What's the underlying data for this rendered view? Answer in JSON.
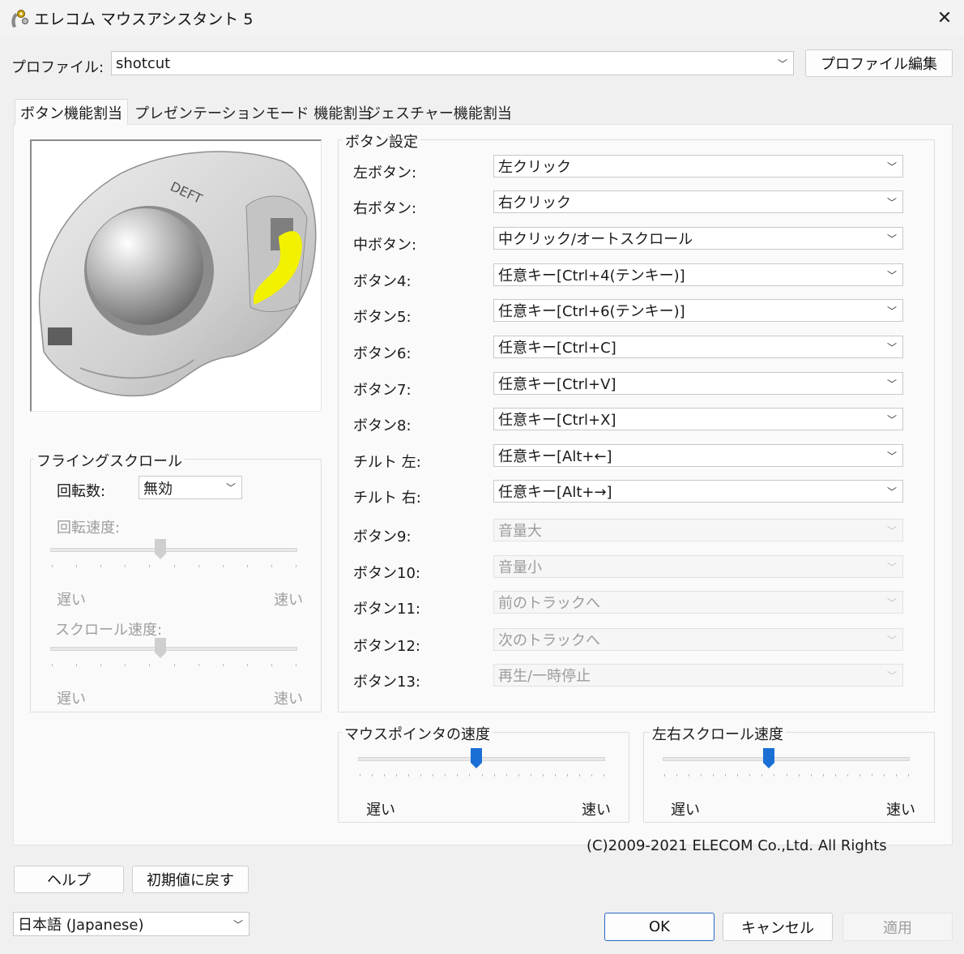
{
  "window": {
    "title": "エレコム マウスアシスタント 5",
    "close_icon": "close-icon"
  },
  "profile": {
    "label": "プロファイル:",
    "value": "shotcut",
    "edit_button": "プロファイル編集"
  },
  "tabs": [
    {
      "label": "ボタン機能割当",
      "active": true
    },
    {
      "label": "プレゼンテーションモード 機能割当",
      "active": false
    },
    {
      "label": "ジェスチャー機能割当",
      "active": false
    }
  ],
  "button_settings": {
    "title": "ボタン設定",
    "rows": [
      {
        "label": "左ボタン:",
        "value": "左クリック",
        "enabled": true
      },
      {
        "label": "右ボタン:",
        "value": "右クリック",
        "enabled": true
      },
      {
        "label": "中ボタン:",
        "value": "中クリック/オートスクロール",
        "enabled": true
      },
      {
        "label": "ボタン4:",
        "value": "任意キー[Ctrl+4(テンキー)]",
        "enabled": true
      },
      {
        "label": "ボタン5:",
        "value": "任意キー[Ctrl+6(テンキー)]",
        "enabled": true
      },
      {
        "label": "ボタン6:",
        "value": "任意キー[Ctrl+C]",
        "enabled": true
      },
      {
        "label": "ボタン7:",
        "value": "任意キー[Ctrl+V]",
        "enabled": true
      },
      {
        "label": "ボタン8:",
        "value": "任意キー[Ctrl+X]",
        "enabled": true
      },
      {
        "label": "チルト 左:",
        "value": "任意キー[Alt+←]",
        "enabled": true
      },
      {
        "label": "チルト 右:",
        "value": "任意キー[Alt+→]",
        "enabled": true
      },
      {
        "label": "ボタン9:",
        "value": "音量大",
        "enabled": false
      },
      {
        "label": "ボタン10:",
        "value": "音量小",
        "enabled": false
      },
      {
        "label": "ボタン11:",
        "value": "前のトラックへ",
        "enabled": false
      },
      {
        "label": "ボタン12:",
        "value": "次のトラックへ",
        "enabled": false
      },
      {
        "label": "ボタン13:",
        "value": "再生/一時停止",
        "enabled": false
      }
    ]
  },
  "flying_scroll": {
    "title": "フライングスクロール",
    "rotation_label": "回転数:",
    "rotation_value": "無効",
    "rotation_speed_label": "回転速度:",
    "rotation_speed_level": 0.45,
    "scroll_speed_label": "スクロール速度:",
    "scroll_speed_level": 0.45,
    "slow": "遅い",
    "fast": "速い"
  },
  "pointer_speed": {
    "title": "マウスポインタの速度",
    "level": 0.48,
    "slow": "遅い",
    "fast": "速い"
  },
  "horizontal_scroll_speed": {
    "title": "左右スクロール速度",
    "level": 0.43,
    "slow": "遅い",
    "fast": "速い"
  },
  "copyright": "(C)2009-2021 ELECOM Co.,Ltd. All Rights",
  "bottom": {
    "help": "ヘルプ",
    "reset": "初期値に戻す",
    "language": "日本語 (Japanese)",
    "ok": "OK",
    "cancel": "キャンセル",
    "apply": "適用"
  },
  "colors": {
    "slider_thumb_active": "#1a6fd4",
    "slider_thumb_disabled": "#cfcfcf",
    "highlight_button": "#f2f200"
  }
}
